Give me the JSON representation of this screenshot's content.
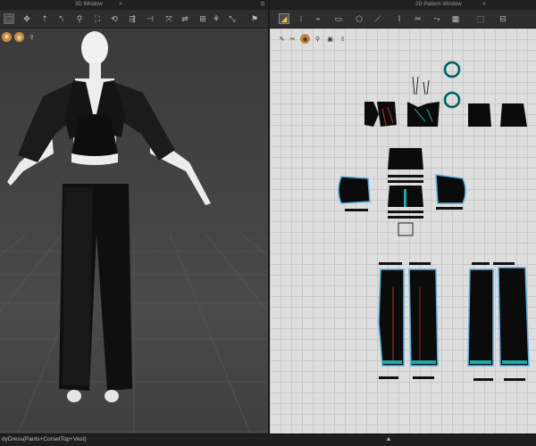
{
  "window_3d": {
    "title": "3D Window",
    "toolbar_icons": [
      "select-mesh-icon",
      "move-icon",
      "tack-icon",
      "fold-icon",
      "pin-icon",
      "box-select-icon",
      "lasso-icon",
      "measure-icon",
      "ruler-icon",
      "arrange-icon",
      "puckering-icon",
      "avatar-pose-icon",
      "strap-icon",
      "trim-icon",
      "walk-icon"
    ],
    "view_tools": [
      "avatar-icon",
      "texture-icon",
      "export-icon"
    ]
  },
  "window_2d": {
    "title": "2D Pattern Window",
    "toolbar_icons": [
      "transform-pattern-icon",
      "edit-point-icon",
      "curve-point-icon",
      "rectangle-icon",
      "polygon-icon",
      "internal-line-icon",
      "segment-icon",
      "sewing-icon",
      "free-sewing-icon",
      "trace-icon",
      "fold-arrange-icon",
      "symmetry-icon"
    ],
    "view_tools": [
      "brush-icon",
      "scissor-icon",
      "texture-icon",
      "pin-icon",
      "internal-icon",
      "export-icon"
    ]
  },
  "status": {
    "text": "dyDress(Pants+CorsetTop+Vest)"
  },
  "colors": {
    "accent": "#f0c040",
    "garment": "#111111",
    "pattern_outline": "#5ab0e0",
    "stitch_teal": "#1fa8a8",
    "stitch_red": "#c03030"
  }
}
